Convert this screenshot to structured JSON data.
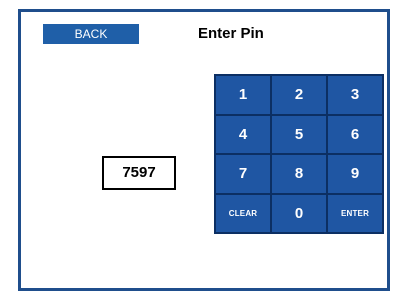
{
  "header": {
    "back_label": "BACK",
    "title": "Enter Pin"
  },
  "pin": {
    "value": "7597"
  },
  "keypad": {
    "keys": [
      "1",
      "2",
      "3",
      "4",
      "5",
      "6",
      "7",
      "8",
      "9",
      "CLEAR",
      "0",
      "ENTER"
    ]
  },
  "colors": {
    "accent": "#1f56a3",
    "border": "#1f4e8c"
  }
}
